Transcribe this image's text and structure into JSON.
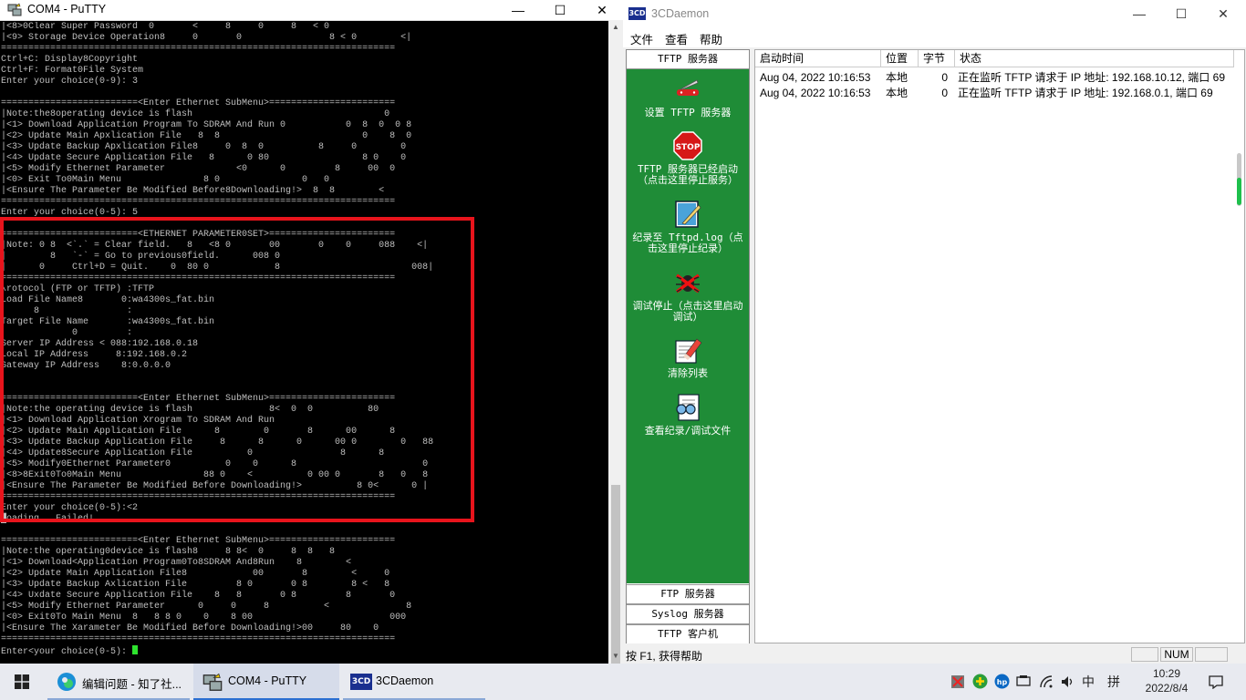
{
  "putty": {
    "title": "COM4 - PuTTY",
    "controls": {
      "minimize": "—",
      "maximize": "☐",
      "close": "✕"
    },
    "terminal_lines": [
      "|<8>0Clear Super Password  0       <     8     0     8   < 0",
      "|<9> Storage Device Operation8     0       0                8 < 0        <|",
      "========================================================================",
      "Ctrl+C: Display8Copyright",
      "Ctrl+F: Format0File System",
      "Enter your choice(0-9): 3",
      "",
      "=========================<Enter Ethernet SubMenu>=======================",
      "|Note:the8operating device is flash                                   0",
      "|<1> Download Application Program To SDRAM And Run 0           0  8  0  0 8",
      "|<2> Update Main Apxlication File   8  8                          0    8  0",
      "|<3> Update Backup Apxlication File8     0  8  0          8     0        0",
      "|<4> Update Secure Application File   8      0 80                 8 0    0",
      "|<5> Modify Ethernet Parameter             <0      0         8     00  0",
      "|<0> Exit To0Main Menu               8 0               0   0",
      "|<Ensure The Parameter Be Modified Before8Downloading!>  8  8        <",
      "========================================================================",
      "Enter your choice(0-5): 5",
      "",
      "=========================<ETHERNET PARAMETER0SET>=======================",
      "|Note: 0 8  <`.` = Clear field.   8   <8 0       00       0    0     088    <|",
      "|        8   `-` = Go to previous0field.      008 0",
      "|      0     Ctrl+D = Quit.    0  80 0            8                        008|",
      "========================================================================",
      "\\rotocol (FTP or TFTP) :TFTP",
      "Load File Name8       0:wa4300s_fat.bin",
      "      8                :",
      "Target File Name       :wa4300s_fat.bin",
      "             0         :",
      "Server IP Address < 088:192.168.0.18",
      "Local IP Address     8:192.168.0.2",
      "Gateway IP Address    8:0.0.0.0",
      "",
      "",
      "=========================<Enter Ethernet SubMenu>=======================",
      "|Note:the operating device is flash              8<  0  0          80",
      "|<1> Download Application Xrogram To SDRAM And Run",
      "|<2> Update Main Application File      8        0       8      00      8",
      "|<3> Update Backup Application File     8      8      0      00 0        0   88",
      "|<4> Update8Secure Application File          0                8      8",
      "|<5> Modify0Ethernet Parameter0          0    0      8                       0",
      "|<8>8Exit0To0Main Menu               88 0    <          0 00 0       8   0   8",
      "|<Ensure The Parameter Be Modified Before Downloading!>          8 0<      0 |",
      "========================================================================",
      "Enter your choice(0-5):<2",
      "█oading...Failed!",
      "",
      "=========================<Enter Ethernet SubMenu>=======================",
      "|Note:the operating0device is flash8     8 8<  0     8  8   8",
      "|<1> Download<Application Program0To8SDRAM And8Run    8        <",
      "|<2> Update Main Application File8            00       8        <     0",
      "|<3> Update Backup Axlication File         8 0       0 8        8 <   8",
      "|<4> Uxdate Secure Application File    8   8       0 8         8       0",
      "|<5> Modify Ethernet Parameter      0     0     8          <              8",
      "|<0> Exit0To Main Menu  8   8 8 0    0    8 00                         000",
      "|<Ensure The Xarameter Be Modified Before Downloading!>00     80    0",
      "========================================================================"
    ],
    "prompt": "Enter<your choice(0-5): "
  },
  "daemon": {
    "title": "3CDaemon",
    "icon_text": "3CD",
    "controls": {
      "minimize": "—",
      "maximize": "☐",
      "close": "✕"
    },
    "menu": [
      "文件",
      "查看",
      "帮助"
    ],
    "side_header": "TFTP 服务器",
    "side_items": [
      {
        "label": "设置 TFTP 服务器",
        "icon": "knife-settings-icon"
      },
      {
        "label": "TFTP 服务器已经启动（点击这里停止服务）",
        "icon": "stop-sign-icon",
        "icon_text": "STOP"
      },
      {
        "label": "纪录至 Tftpd.log（点击这里停止纪录）",
        "icon": "notepad-icon"
      },
      {
        "label": "调试停止（点击这里启动调试）",
        "icon": "bug-icon"
      },
      {
        "label": "清除列表",
        "icon": "eraser-icon"
      },
      {
        "label": "查看纪录/调试文件",
        "icon": "view-log-icon"
      }
    ],
    "bottom_tabs": [
      "FTP 服务器",
      "Syslog 服务器",
      "TFTP 客户机"
    ],
    "columns": [
      "启动时间",
      "位置",
      "字节",
      "状态"
    ],
    "rows": [
      {
        "time": "Aug 04, 2022 10:16:53",
        "location": "本地",
        "bytes": "0",
        "status": "正在监听 TFTP 请求于 IP 地址: 192.168.10.12, 端口 69"
      },
      {
        "time": "Aug 04, 2022 10:16:53",
        "location": "本地",
        "bytes": "0",
        "status": "正在监听 TFTP 请求于 IP 地址: 192.168.0.1, 端口 69"
      }
    ],
    "status_text": "按 F1, 获得帮助",
    "status_num": "NUM"
  },
  "taskbar": {
    "items": [
      {
        "label": "编辑问题 - 知了社...",
        "icon": "edge-browser-icon"
      },
      {
        "label": "COM4 - PuTTY",
        "icon": "putty-icon"
      },
      {
        "label": "3CDaemon",
        "icon": "3cdaemon-icon",
        "icon_text": "3CD"
      }
    ],
    "ime_lang": "中",
    "ime_mode": "拼",
    "time": "10:29",
    "date": "2022/8/4"
  },
  "colors": {
    "highlight": "#e8141c",
    "sidebar_green": "#1f8c37",
    "terminal_bg": "#000000",
    "cursor": "#2ee32e"
  }
}
